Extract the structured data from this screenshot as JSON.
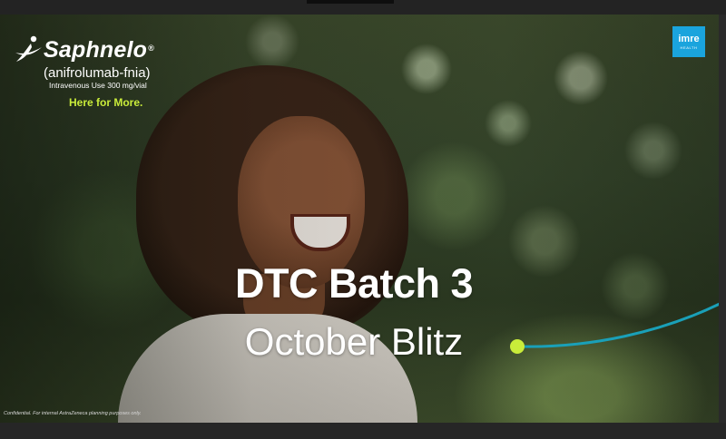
{
  "slide": {
    "brand": {
      "name": "Saphnelo",
      "registered_mark": "®",
      "generic_name": "(anifrolumab-fnia)",
      "dosage_form": "Intravenous Use 300 mg/vial",
      "more_link": "Here for More.",
      "accent_color": "#c9ec3a"
    },
    "agency": {
      "name": "imre",
      "sub": "HEALTH",
      "color": "#1aa4dd"
    },
    "headline": "DTC Batch 3",
    "subheadline": "October Blitz",
    "accent_line_color": "#1aa0b8",
    "accent_dot_color": "#c9ec3a",
    "disclaimer": "Confidential. For internal AstraZeneca planning purposes only."
  }
}
